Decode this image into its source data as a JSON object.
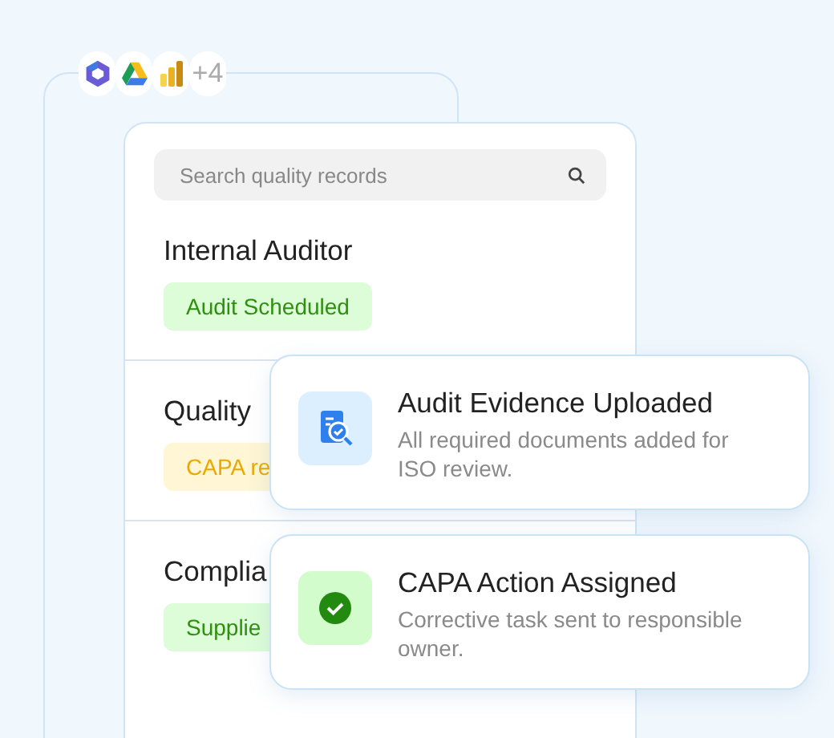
{
  "apps": {
    "more_count": "+4"
  },
  "search": {
    "placeholder": "Search quality records"
  },
  "records": [
    {
      "title": "Internal Auditor",
      "status": {
        "label": "Audit Scheduled",
        "kind": "success"
      }
    },
    {
      "title": "Quality",
      "status": {
        "label": "CAPA re",
        "kind": "warning"
      }
    },
    {
      "title": "Complia",
      "status": {
        "label": "Supplie",
        "kind": "success"
      }
    }
  ],
  "notifications": [
    {
      "kind": "document",
      "title": "Audit Evidence Uploaded",
      "text": "All required documents added for ISO review."
    },
    {
      "kind": "check",
      "title": "CAPA Action Assigned",
      "text": "Corrective task sent to responsible owner."
    }
  ]
}
